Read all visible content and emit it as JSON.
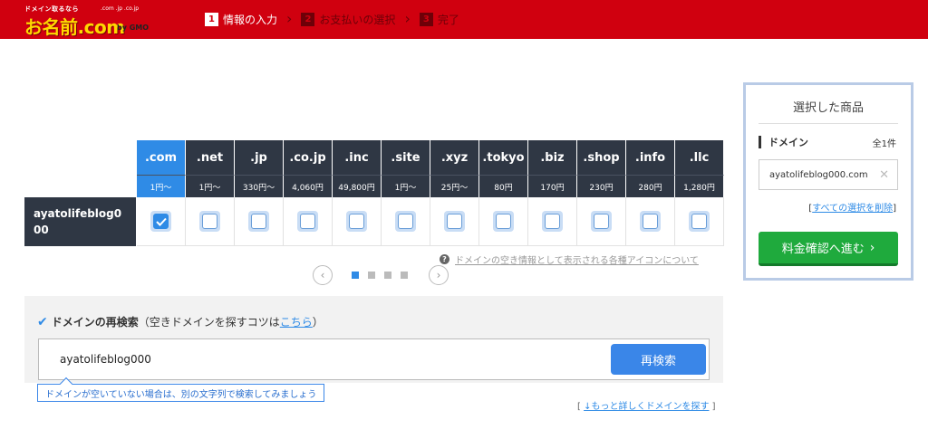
{
  "header": {
    "logo_tagline": "ドメイン取るなら",
    "logo_tlds": ".com .jp .co.jp",
    "logo_main": "お名前.com",
    "logo_by": "by GMO",
    "steps": [
      {
        "num": "1",
        "label": "情報の入力",
        "active": true
      },
      {
        "num": "2",
        "label": "お支払いの選択",
        "active": false
      },
      {
        "num": "3",
        "label": "完了",
        "active": false
      }
    ]
  },
  "domain_table": {
    "domain_name": "ayatolifeblog000",
    "columns": [
      {
        "tld": ".com",
        "price": "1円〜",
        "selected": true,
        "checked": true
      },
      {
        "tld": ".net",
        "price": "1円〜",
        "selected": false,
        "checked": false
      },
      {
        "tld": ".jp",
        "price": "330円〜",
        "selected": false,
        "checked": false
      },
      {
        "tld": ".co.jp",
        "price": "4,060円",
        "selected": false,
        "checked": false
      },
      {
        "tld": ".inc",
        "price": "49,800円",
        "selected": false,
        "checked": false
      },
      {
        "tld": ".site",
        "price": "1円〜",
        "selected": false,
        "checked": false
      },
      {
        "tld": ".xyz",
        "price": "25円〜",
        "selected": false,
        "checked": false
      },
      {
        "tld": ".tokyo",
        "price": "80円",
        "selected": false,
        "checked": false
      },
      {
        "tld": ".biz",
        "price": "170円",
        "selected": false,
        "checked": false
      },
      {
        "tld": ".shop",
        "price": "230円",
        "selected": false,
        "checked": false
      },
      {
        "tld": ".info",
        "price": "280円",
        "selected": false,
        "checked": false
      },
      {
        "tld": ".llc",
        "price": "1,280円",
        "selected": false,
        "checked": false
      }
    ],
    "icon_note": "ドメインの空き情報として表示される各種アイコンについて",
    "pager": {
      "pages": 4,
      "current": 1
    }
  },
  "research": {
    "title_bold": "ドメインの再検索",
    "title_rest_before": "（空きドメインを探すコツは",
    "title_link": "こちら",
    "title_rest_after": "）",
    "input_value": "ayatolifeblog000",
    "button_label": "再検索",
    "hint": "ドメインが空いていない場合は、別の文字列で検索してみましょう",
    "more_link": "↓もっと詳しくドメインを探す"
  },
  "side_panel": {
    "title": "選択した商品",
    "section_label": "ドメイン",
    "count": "全1件",
    "selected_item": "ayatolifeblog000.com",
    "clear_link": "すべての選択を削除",
    "cta_label": "料金確認へ進む"
  },
  "colors": {
    "header_red": "#d0000f",
    "selected_blue": "#2f8be6",
    "table_dark": "#2f3744",
    "cta_green": "#1faa3d"
  }
}
